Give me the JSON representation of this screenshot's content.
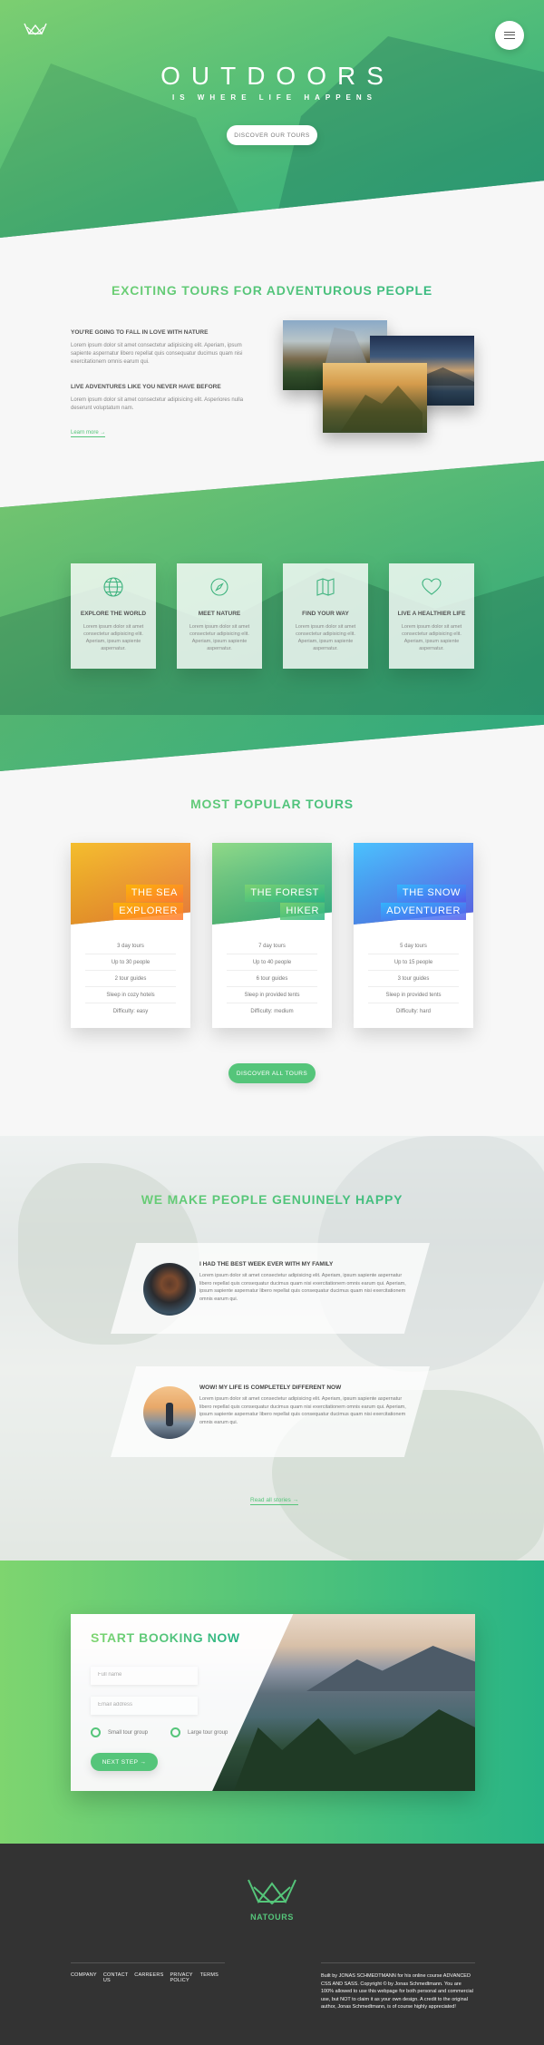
{
  "hero": {
    "logo_icon": "crown-logo-icon",
    "menu_icon": "menu-icon",
    "title": "OUTDOORS",
    "subtitle": "IS WHERE LIFE HAPPENS",
    "cta": "DISCOVER OUR TOURS"
  },
  "about": {
    "heading": "EXCITING TOURS FOR ADVENTUROUS PEOPLE",
    "h1": "YOU'RE GOING TO FALL IN LOVE WITH NATURE",
    "p1": "Lorem ipsum dolor sit amet consectetur adipisicing elit. Aperiam, ipsum sapiente aspernatur libero repellat quis consequatur ducimus quam nisi exercitationem omnis earum qui.",
    "h2": "LIVE ADVENTURES LIKE YOU NEVER HAVE BEFORE",
    "p2": "Lorem ipsum dolor sit amet consectetur adipisicing elit. Asperiores nulla deserunt voluptatum nam.",
    "link": "Learn more →"
  },
  "features": [
    {
      "icon": "globe-icon",
      "title": "EXPLORE THE WORLD",
      "text": "Lorem ipsum dolor sit amet consectetur adipisicing elit. Aperiam, ipsum sapiente aspernatur."
    },
    {
      "icon": "compass-icon",
      "title": "MEET NATURE",
      "text": "Lorem ipsum dolor sit amet consectetur adipisicing elit. Aperiam, ipsum sapiente aspernatur."
    },
    {
      "icon": "map-icon",
      "title": "FIND YOUR WAY",
      "text": "Lorem ipsum dolor sit amet consectetur adipisicing elit. Aperiam, ipsum sapiente aspernatur."
    },
    {
      "icon": "heart-icon",
      "title": "LIVE A HEALTHIER LIFE",
      "text": "Lorem ipsum dolor sit amet consectetur adipisicing elit. Aperiam, ipsum sapiente aspernatur."
    }
  ],
  "tours": {
    "heading": "MOST POPULAR TOURS",
    "cards": [
      {
        "name1": "THE SEA",
        "name2": "EXPLORER",
        "details": [
          "3 day tours",
          "Up to 30 people",
          "2 tour guides",
          "Sleep in cozy hotels",
          "Difficulty: easy"
        ]
      },
      {
        "name1": "THE FOREST",
        "name2": "HIKER",
        "details": [
          "7 day tours",
          "Up to 40 people",
          "6 tour guides",
          "Sleep in provided tents",
          "Difficulty: medium"
        ]
      },
      {
        "name1": "THE SNOW",
        "name2": "ADVENTURER",
        "details": [
          "5 day tours",
          "Up to 15 people",
          "3 tour guides",
          "Sleep in provided tents",
          "Difficulty: hard"
        ]
      }
    ],
    "cta": "DISCOVER ALL TOURS"
  },
  "stories": {
    "heading": "WE MAKE PEOPLE GENUINELY HAPPY",
    "items": [
      {
        "title": "I HAD THE BEST WEEK EVER WITH MY FAMILY",
        "text": "Lorem ipsum dolor sit amet consectetur adipisicing elit. Aperiam, ipsum sapiente aspernatur libero repellat quis consequatur ducimus quam nisi exercitationem omnis earum qui. Aperiam, ipsum sapiente aspernatur libero repellat quis consequatur ducimus quam nisi exercitationem omnis earum qui."
      },
      {
        "title": "WOW! MY LIFE IS COMPLETELY DIFFERENT NOW",
        "text": "Lorem ipsum dolor sit amet consectetur adipisicing elit. Aperiam, ipsum sapiente aspernatur libero repellat quis consequatur ducimus quam nisi exercitationem omnis earum qui. Aperiam, ipsum sapiente aspernatur libero repellat quis consequatur ducimus quam nisi exercitationem omnis earum qui."
      }
    ],
    "link": "Read all stories →"
  },
  "booking": {
    "heading": "START BOOKING NOW",
    "full_name_placeholder": "Full name",
    "email_placeholder": "Email address",
    "radio_small": "Small tour group",
    "radio_large": "Large tour group",
    "cta": "NEXT STEP →"
  },
  "footer": {
    "brand": "NATOURS",
    "nav": [
      "COMPANY",
      "CONTACT US",
      "CARREERS",
      "PRIVACY POLICY",
      "TERMS"
    ],
    "copyright": "Built by JONAS SCHMEDTMANN for his online course ADVANCED CSS AND SASS. Copyright © by Jonas Schmedtmann. You are 100% allowed to use this webpage for both personal and commercial use, but NOT to claim it as your own design. A credit to the original author, Jonas Schmedtmann, is of course highly appreciated!"
  },
  "colors": {
    "primary": "#55c57a",
    "primary_light": "#7ed56f",
    "primary_dark": "#28b485",
    "footer_bg": "#333333"
  }
}
